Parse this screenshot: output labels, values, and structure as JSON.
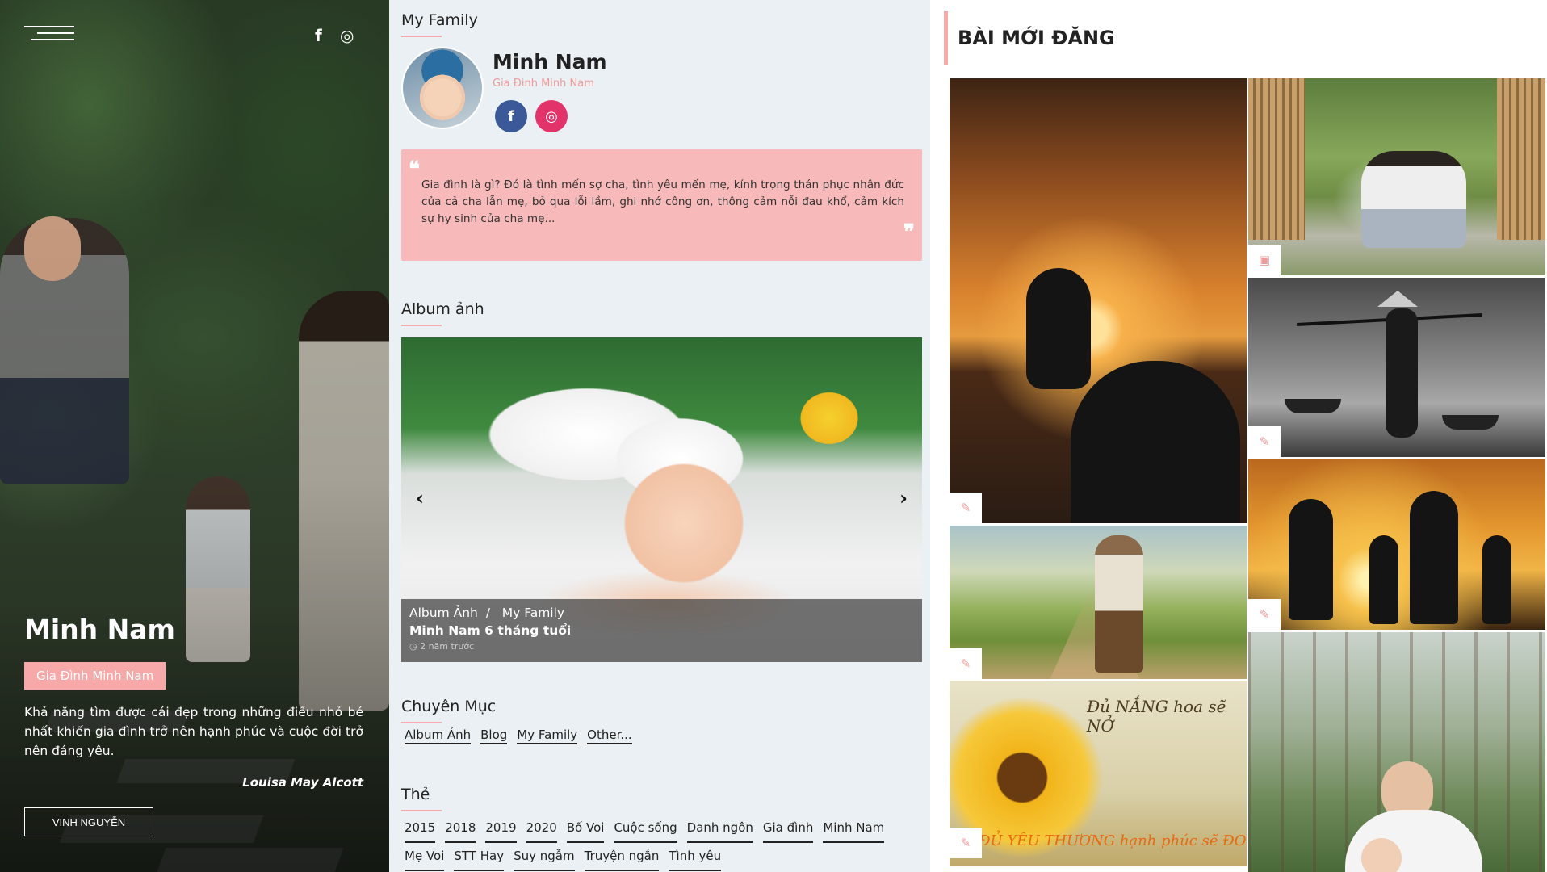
{
  "hero": {
    "menu_icon": "hamburger-menu-icon",
    "social": [
      "f",
      "◎"
    ],
    "name": "Minh Nam",
    "badge": "Gia Đình Minh Nam",
    "quote": "Khả năng tìm được cái đẹp trong những điều nhỏ bé nhất khiến gia đình trở nên hạnh phúc và cuộc đời trở nên đáng yêu.",
    "author": "Louisa May Alcott",
    "button": "VINH NGUYỄN"
  },
  "profile": {
    "section_title": "My Family",
    "name": "Minh Nam",
    "subtitle": "Gia Đình Minh Nam",
    "facebook_glyph": "f",
    "instagram_glyph": "◎",
    "colors": {
      "facebook": "#3b5998",
      "instagram": "#e2336b"
    }
  },
  "quote_box": {
    "open_mark": "❝",
    "close_mark": "❞",
    "text": "Gia đình là gì? Đó là tình mến sợ cha, tình yêu mến mẹ, kính trọng thán phục nhân đức của cả cha lẫn mẹ, bỏ qua lỗi lầm, ghi nhớ công ơn, thông cảm nỗi đau khổ, cảm kích sự hy sinh của cha mẹ..."
  },
  "album": {
    "section_title": "Album ảnh",
    "prev": "‹",
    "next": "›",
    "crumb_1": "Album Ảnh",
    "crumb_sep": "/",
    "crumb_2": "My Family",
    "title": "Minh Nam 6 tháng tuổi",
    "time": "◷ 2 năm trước"
  },
  "categories": {
    "section_title": "Chuyên Mục",
    "items": [
      "Album Ảnh",
      "Blog",
      "My Family",
      "Other..."
    ]
  },
  "tags": {
    "section_title": "Thẻ",
    "items": [
      "2015",
      "2018",
      "2019",
      "2020",
      "Bố Voi",
      "Cuộc sống",
      "Danh ngôn",
      "Gia đình",
      "Minh Nam",
      "Mẹ Voi",
      "STT Hay",
      "Suy ngẫm",
      "Truyện ngắn",
      "Tình yêu"
    ]
  },
  "recent": {
    "title": "BÀI MỚI ĐĂNG",
    "sunflower_text_top": "Đủ NẮNG hoa sẽ NỞ",
    "sunflower_text_bottom": "ĐỦ YÊU THƯƠNG hạnh phúc sẽ ĐONG ĐẦY",
    "icon_edit": "✎",
    "icon_image": "▣"
  },
  "accent_color": "#f7a8a8"
}
